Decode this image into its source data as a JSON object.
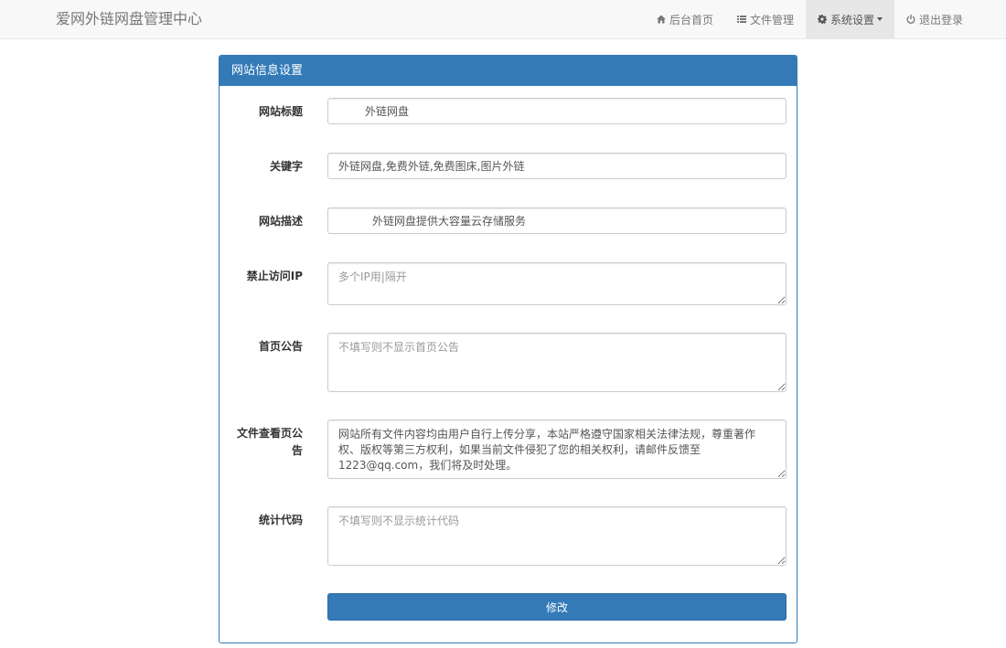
{
  "brand": "爱网外链网盘管理中心",
  "nav": {
    "home": "后台首页",
    "files": "文件管理",
    "settings": "系统设置",
    "logout": "退出登录"
  },
  "panel": {
    "title": "网站信息设置"
  },
  "form": {
    "site_title": {
      "label": "网站标题",
      "value": "外链网盘"
    },
    "keywords": {
      "label": "关键字",
      "value": "外链网盘,免费外链,免费图床,图片外链"
    },
    "description": {
      "label": "网站描述",
      "value": "外链网盘提供大容量云存储服务"
    },
    "blocked_ip": {
      "label": "禁止访问IP",
      "placeholder": "多个IP用|隔开",
      "value": ""
    },
    "home_notice": {
      "label": "首页公告",
      "placeholder": "不填写则不显示首页公告",
      "value": ""
    },
    "file_page_notice": {
      "label": "文件查看页公告",
      "value": "网站所有文件内容均由用户自行上传分享，本站严格遵守国家相关法律法规，尊重著作权、版权等第三方权利，如果当前文件侵犯了您的相关权利，请邮件反馈至1223@qq.com，我们将及时处理。"
    },
    "stats_code": {
      "label": "统计代码",
      "placeholder": "不填写则不显示统计代码",
      "value": ""
    },
    "submit_label": "修改"
  }
}
